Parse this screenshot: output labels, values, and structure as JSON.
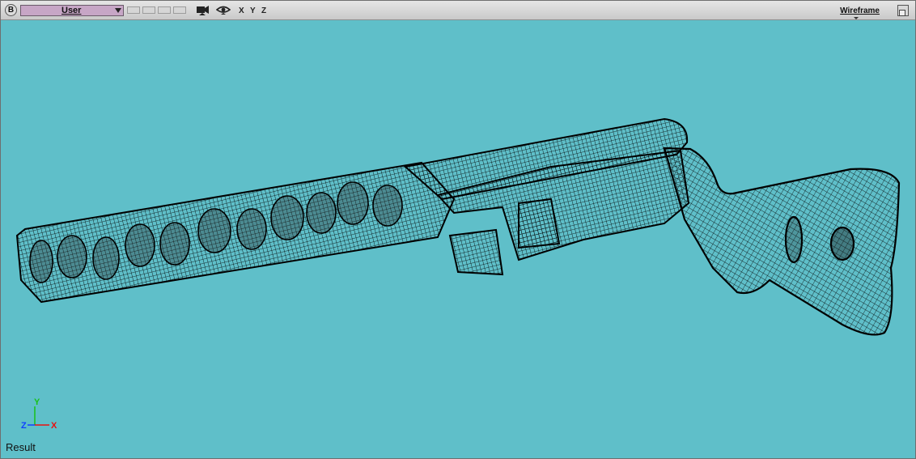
{
  "toolbar": {
    "badge": "B",
    "camera_label": "User",
    "axes": [
      "X",
      "Y",
      "Z"
    ],
    "shading_label": "Wireframe",
    "icons": {
      "badge": "b-badge-icon",
      "camera_dropdown": "chevron-down-icon",
      "camera": "video-camera-icon",
      "visibility": "eye-icon",
      "maximize": "maximize-icon"
    }
  },
  "viewport": {
    "background_color": "#5fbfc9",
    "wire_color": "#000000",
    "axis_triad": {
      "y_label": "Y",
      "z_label": "Z",
      "x_label": "X",
      "x_color": "#e81010",
      "y_color": "#18c018",
      "z_color": "#1040ff"
    },
    "status_label": "Result"
  }
}
